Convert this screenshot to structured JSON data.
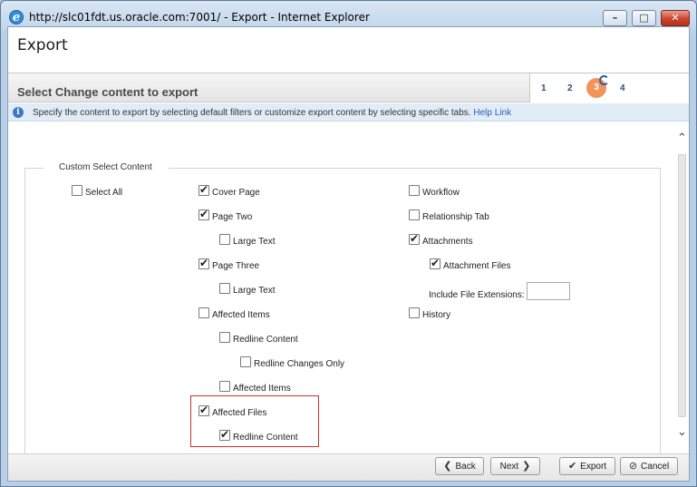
{
  "window": {
    "title": "http://slc01fdt.us.oracle.com:7001/ - Export - Internet Explorer",
    "minimize": "–",
    "maximize": "□",
    "close": "✕"
  },
  "dialog": {
    "title": "Export",
    "step_title": "Select Change content to export",
    "steps": [
      "1",
      "2",
      "3",
      "4"
    ],
    "active_step": "3",
    "info_text": "Specify the content to export by selecting default filters or customize export content by selecting specific tabs.",
    "info_link": "Help Link"
  },
  "content": {
    "section_title": "Custom Select Content",
    "options": {
      "select_all": {
        "label": "Select All",
        "checked": false
      },
      "cover_page": {
        "label": "Cover Page",
        "checked": true
      },
      "page_two": {
        "label": "Page Two",
        "checked": true
      },
      "page_two_large_text": {
        "label": "Large Text",
        "checked": false
      },
      "page_three": {
        "label": "Page Three",
        "checked": true
      },
      "page_three_large_text": {
        "label": "Large Text",
        "checked": false
      },
      "affected_items": {
        "label": "Affected Items",
        "checked": false
      },
      "redline_content": {
        "label": "Redline Content",
        "checked": false
      },
      "redline_changes_only": {
        "label": "Redline Changes Only",
        "checked": false
      },
      "affected_items_sub": {
        "label": "Affected Items",
        "checked": false
      },
      "affected_files": {
        "label": "Affected Files",
        "checked": true
      },
      "affected_files_redline": {
        "label": "Redline Content",
        "checked": true
      },
      "workflow": {
        "label": "Workflow",
        "checked": false
      },
      "relationship_tab": {
        "label": "Relationship Tab",
        "checked": false
      },
      "attachments": {
        "label": "Attachments",
        "checked": true
      },
      "attachment_files": {
        "label": "Attachment Files",
        "checked": true
      },
      "history": {
        "label": "History",
        "checked": false
      }
    },
    "file_extensions_label": "Include File Extensions:",
    "file_extensions_value": ""
  },
  "footer": {
    "back": "Back",
    "next": "Next",
    "export": "Export",
    "cancel": "Cancel"
  }
}
